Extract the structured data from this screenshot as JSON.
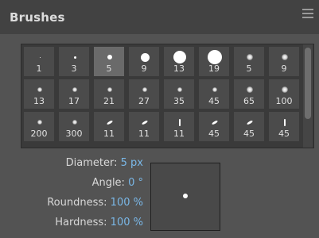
{
  "panel": {
    "title": "Brushes",
    "menu_icon": "hamburger-menu-icon"
  },
  "brushes": [
    {
      "size_label": "1",
      "tip": "round-dot"
    },
    {
      "size_label": "3",
      "tip": "round-dot"
    },
    {
      "size_label": "5",
      "tip": "round-dot",
      "selected": true
    },
    {
      "size_label": "9",
      "tip": "round-dot"
    },
    {
      "size_label": "13",
      "tip": "round-dot"
    },
    {
      "size_label": "19",
      "tip": "round-dot"
    },
    {
      "size_label": "5",
      "tip": "soft-dot"
    },
    {
      "size_label": "9",
      "tip": "soft-dot"
    },
    {
      "size_label": "13",
      "tip": "soft-dot"
    },
    {
      "size_label": "17",
      "tip": "soft-dot"
    },
    {
      "size_label": "21",
      "tip": "soft-dot"
    },
    {
      "size_label": "27",
      "tip": "soft-dot"
    },
    {
      "size_label": "35",
      "tip": "soft-dot"
    },
    {
      "size_label": "45",
      "tip": "soft-dot"
    },
    {
      "size_label": "65",
      "tip": "soft-dot"
    },
    {
      "size_label": "100",
      "tip": "soft-dot"
    },
    {
      "size_label": "200",
      "tip": "soft-dot"
    },
    {
      "size_label": "300",
      "tip": "soft-dot"
    },
    {
      "size_label": "11",
      "tip": "angled-stroke"
    },
    {
      "size_label": "11",
      "tip": "angled-stroke"
    },
    {
      "size_label": "11",
      "tip": "vertical-stroke"
    },
    {
      "size_label": "45",
      "tip": "angled-stroke"
    },
    {
      "size_label": "45",
      "tip": "angled-stroke"
    },
    {
      "size_label": "45",
      "tip": "vertical-stroke"
    }
  ],
  "props": {
    "diameter": {
      "label": "Diameter:",
      "value": "5",
      "unit": "px"
    },
    "angle": {
      "label": "Angle:",
      "value": "0",
      "unit": "°"
    },
    "roundness": {
      "label": "Roundness:",
      "value": "100",
      "unit": "%"
    },
    "hardness": {
      "label": "Hardness:",
      "value": "100",
      "unit": "%"
    }
  },
  "colors": {
    "accent": "#7ab8e8",
    "panel_bg": "#535353",
    "header_bg": "#424242"
  }
}
